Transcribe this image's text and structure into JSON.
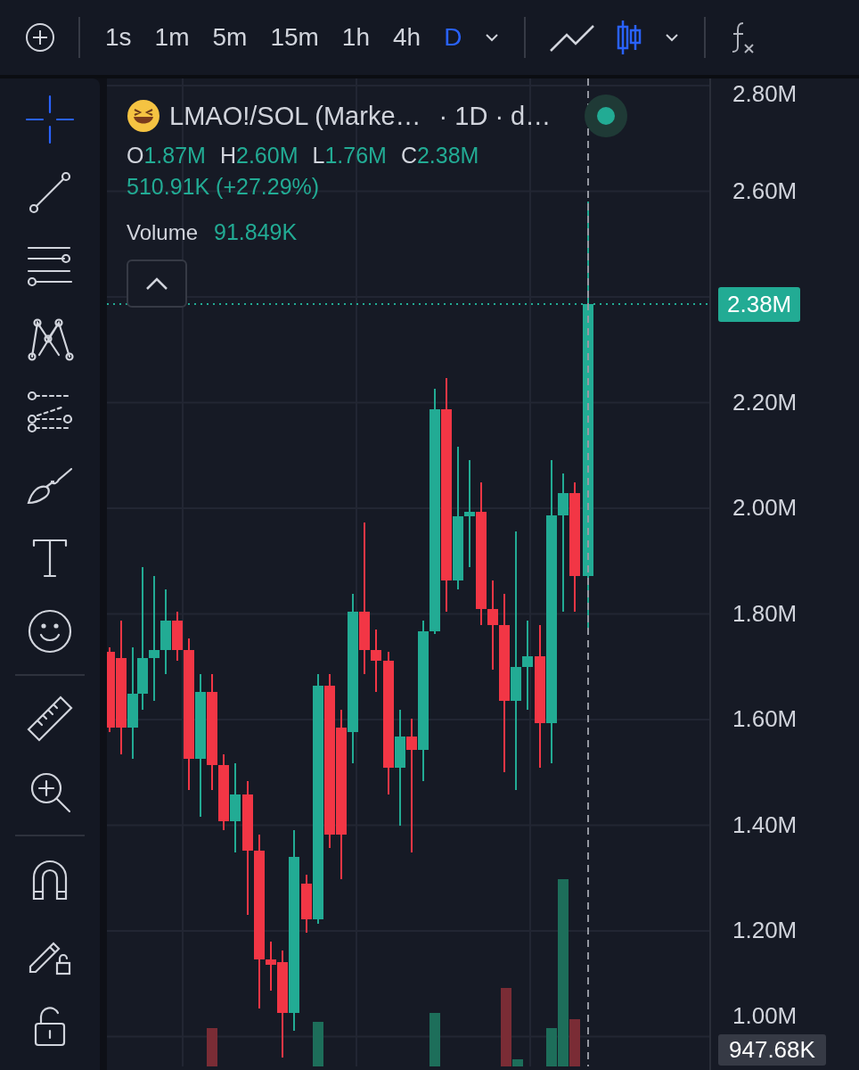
{
  "toolbar": {
    "intervals": [
      {
        "label": "1s",
        "selected": false
      },
      {
        "label": "1m",
        "selected": false
      },
      {
        "label": "5m",
        "selected": false
      },
      {
        "label": "15m",
        "selected": false
      },
      {
        "label": "1h",
        "selected": false
      },
      {
        "label": "4h",
        "selected": false
      },
      {
        "label": "D",
        "selected": true
      }
    ],
    "chart_styles": [
      {
        "kind": "line",
        "selected": false
      },
      {
        "kind": "candles",
        "selected": true
      }
    ]
  },
  "tool_groups": [
    [
      {
        "kind": "crosshair",
        "selected": true
      },
      {
        "kind": "trend-line",
        "selected": false
      },
      {
        "kind": "fib",
        "selected": false
      },
      {
        "kind": "pattern",
        "selected": false
      },
      {
        "kind": "forecast",
        "selected": false
      },
      {
        "kind": "brush",
        "selected": false
      },
      {
        "kind": "text",
        "selected": false
      },
      {
        "kind": "emoji",
        "selected": false
      }
    ],
    [
      {
        "kind": "ruler",
        "selected": false
      },
      {
        "kind": "zoom",
        "selected": false
      }
    ],
    [
      {
        "kind": "magnet",
        "selected": false
      },
      {
        "kind": "lock-drawings",
        "selected": false
      },
      {
        "kind": "lock",
        "selected": false
      }
    ]
  ],
  "legend": {
    "title": "LMAO!/SOL (Marke…",
    "interval": "· 1D · d…",
    "ohlc": [
      {
        "key": "O",
        "value": "1.87M"
      },
      {
        "key": "H",
        "value": "2.60M"
      },
      {
        "key": "L",
        "value": "1.76M"
      },
      {
        "key": "C",
        "value": "2.38M"
      }
    ],
    "change": "510.91K (+27.29%)",
    "volume_label": "Volume",
    "volume_value": "91.849K"
  },
  "price_axis": {
    "labels": [
      "2.80M",
      "2.60M",
      "2.20M",
      "2.00M",
      "1.80M",
      "1.60M",
      "1.40M",
      "1.20M",
      "1.00M"
    ],
    "current_price": "2.38M",
    "crosshair_price": "947.68K"
  }
}
